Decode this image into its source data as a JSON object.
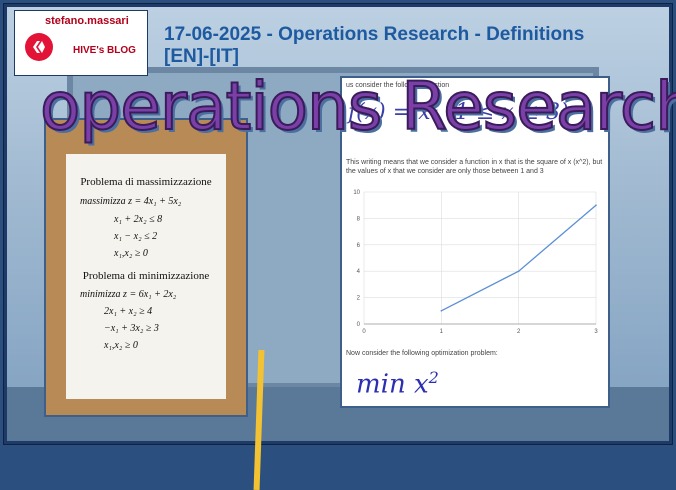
{
  "header": {
    "author": "stefano.massari",
    "blog": "HIVE's BLOG",
    "title": "17-06-2025 - Operations Research - Definitions [EN]-[IT]"
  },
  "banner": {
    "text": "operations Research"
  },
  "left_sheet": {
    "max_title": "Problema di massimizzazione",
    "max_obj": "massimizza z = 4x₁ + 5x₂",
    "max_c1": "x₁ + 2x₂ ≤ 8",
    "max_c2": "x₁ − x₂ ≤ 2",
    "max_c3": "x₁,x₂ ≥ 0",
    "min_title": "Problema di minimizzazione",
    "min_obj": "minimizza z = 6x₁ + 2x₂",
    "min_c1": "2x₁ + x₂ ≥ 4",
    "min_c2": "−x₁ + 3x₂ ≥ 3",
    "min_c3": "x₁,x₂ ≥ 0"
  },
  "right_panel": {
    "intro": "us consider the following function",
    "handwritten_fn": "f(x) = x²  (1 ≤ x ≤ 3)",
    "description": "This writing means that we consider a function in x that is the square of x (x^2), but the values of x that we consider are only those between 1 and 3",
    "consider": "Now consider the following optimization problem:",
    "handwritten_min": "min x",
    "handwritten_exp": "2"
  },
  "chart_data": {
    "type": "line",
    "x": [
      1,
      2,
      3
    ],
    "y": [
      1,
      4,
      9
    ],
    "xlim": [
      0,
      3
    ],
    "ylim": [
      0,
      10
    ],
    "xticks": [
      "0",
      "1",
      "2",
      "3"
    ],
    "yticks": [
      "0",
      "2",
      "4",
      "6",
      "8",
      "10"
    ],
    "line_color": "#5b8fd6",
    "grid": true
  }
}
